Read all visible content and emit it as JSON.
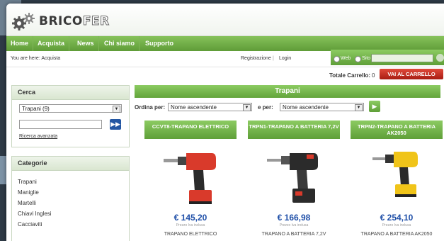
{
  "brand": {
    "part1": "BRICO",
    "part2": "FER"
  },
  "nav": [
    "Home",
    "Acquista",
    "News",
    "Chi siamo",
    "Supporto"
  ],
  "breadcrumb": "You are here: Acquista",
  "account": {
    "register": "Registrazione",
    "separator": "|",
    "login": "Login"
  },
  "search_scope": {
    "web": "Web",
    "site": "Sito"
  },
  "cart": {
    "label": "Totale Carrello:",
    "count": "0",
    "button": "VAI AL CARRELLO"
  },
  "sidebar": {
    "search_title": "Cerca",
    "search_select": "Trapani (9)",
    "advanced_link": "Ricerca avanzata",
    "categories_title": "Categorie",
    "categories": [
      "Trapani",
      "Maniglie",
      "Martelli",
      "Chiavi Inglesi",
      "Cacciaviti"
    ]
  },
  "main": {
    "title": "Trapani",
    "sort_label": "Ordina per:",
    "sort_value": "Nome ascendente",
    "then_label": "e per:",
    "then_value": "Nome ascendente"
  },
  "products": [
    {
      "code": "CCVT8-TRAPANO ELETTRICO",
      "price": "€ 145,20",
      "note": "Prezzo Iva inclusa",
      "name": "TRAPANO ELETTRICO",
      "color": "#d93a2b"
    },
    {
      "code": "TRPN1-TRAPANO A BATTERIA 7,2V",
      "price": "€ 166,98",
      "note": "Prezzo Iva inclusa",
      "name": "TRAPANO A BATTERIA 7,2V",
      "color": "#2b2b2b"
    },
    {
      "code": "TRPN2-TRAPANO A BATTERIA AK2050",
      "price": "€ 254,10",
      "note": "Prezzo Iva inclusa",
      "name": "TRAPANO A BATTERIA AK2050",
      "color": "#f0c419"
    }
  ]
}
